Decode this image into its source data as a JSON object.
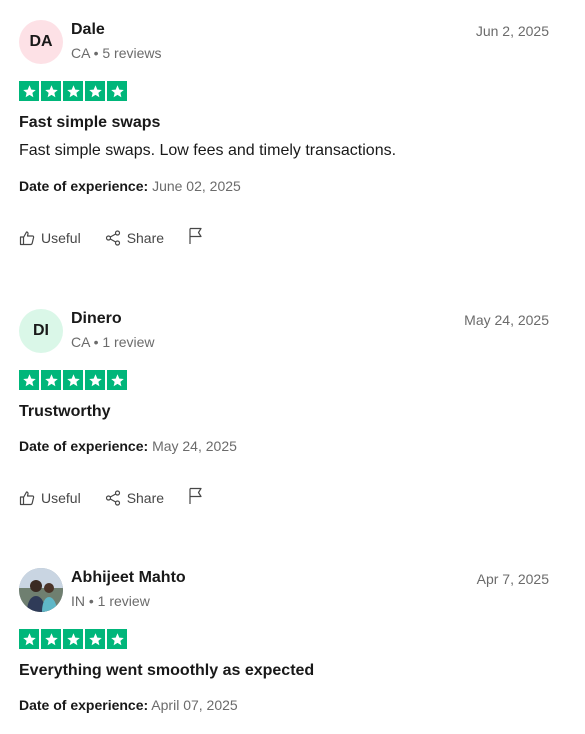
{
  "reviews": [
    {
      "initials": "DA",
      "name": "Dale",
      "meta": "CA • 5 reviews",
      "date": "Jun 2, 2025",
      "title": "Fast simple swaps",
      "body": "Fast simple swaps. Low fees and timely transactions.",
      "exp_label": "Date of experience:",
      "exp_date": "June 02, 2025",
      "useful_label": "Useful",
      "share_label": "Share",
      "rating": 5
    },
    {
      "initials": "DI",
      "name": "Dinero",
      "meta": "CA • 1 review",
      "date": "May 24, 2025",
      "title": "Trustworthy",
      "exp_label": "Date of experience:",
      "exp_date": "May 24, 2025",
      "useful_label": "Useful",
      "share_label": "Share",
      "rating": 5
    },
    {
      "name": "Abhijeet Mahto",
      "meta": "IN • 1 review",
      "date": "Apr 7, 2025",
      "title": "Everything went smoothly as expected",
      "exp_label": "Date of experience:",
      "exp_date": "April 07, 2025",
      "rating": 5
    }
  ],
  "colors": {
    "star_green": "#00b67a",
    "avatar_pink": "#fde1e6",
    "avatar_mint": "#daf7e8",
    "muted_text": "#6b6b6b"
  },
  "icons": [
    "thumbs-up-icon",
    "share-icon",
    "flag-icon",
    "star-icon"
  ]
}
